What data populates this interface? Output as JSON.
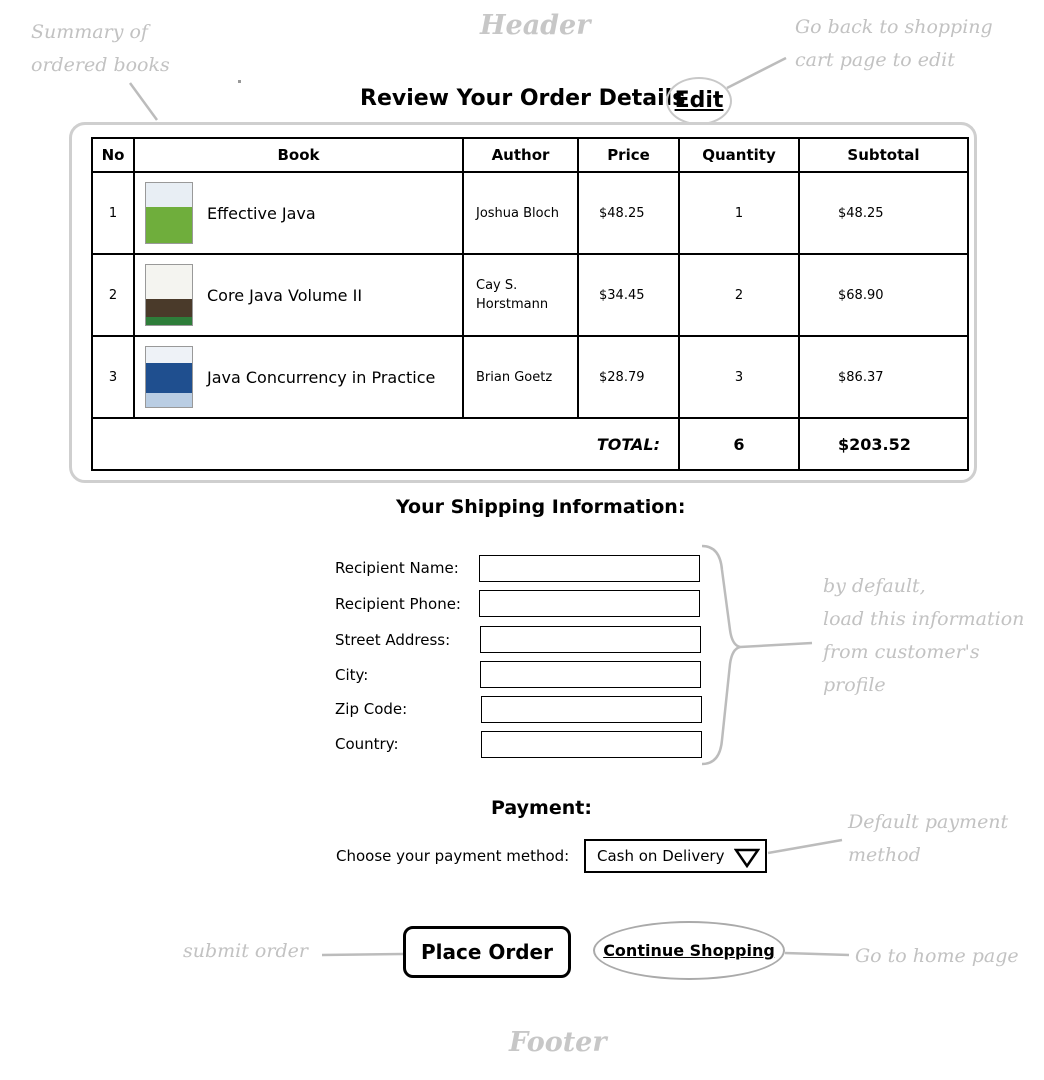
{
  "annotations": {
    "header": "Header",
    "footer": "Footer",
    "summary_note": "Summary of\nordered books",
    "edit_note": "Go back to shopping\ncart page to edit",
    "profile_note": "by default,\nload this information\nfrom customer's\nprofile",
    "payment_note": "Default payment\nmethod",
    "submit_note": "submit order",
    "home_note": "Go to home page"
  },
  "order": {
    "title": "Review Your Order Details",
    "edit_label": "Edit",
    "columns": [
      "No",
      "Book",
      "Author",
      "Price",
      "Quantity",
      "Subtotal"
    ],
    "rows": [
      {
        "no": "1",
        "book": "Effective Java",
        "author": "Joshua Bloch",
        "price": "$48.25",
        "quantity": "1",
        "subtotal": "$48.25",
        "cover_color": "#6fae3c"
      },
      {
        "no": "2",
        "book": "Core Java Volume II",
        "author": "Cay S. Horstmann",
        "price": "$34.45",
        "quantity": "2",
        "subtotal": "$68.90",
        "cover_color": "#2e7d3a"
      },
      {
        "no": "3",
        "book": "Java Concurrency in Practice",
        "author": "Brian Goetz",
        "price": "$28.79",
        "quantity": "3",
        "subtotal": "$86.37",
        "cover_color": "#1f4f8f"
      }
    ],
    "total_label": "TOTAL:",
    "total_quantity": "6",
    "total_amount": "$203.52"
  },
  "shipping": {
    "title": "Your Shipping Information:",
    "fields": [
      {
        "label": "Recipient Name:",
        "value": ""
      },
      {
        "label": "Recipient Phone:",
        "value": ""
      },
      {
        "label": "Street Address:",
        "value": ""
      },
      {
        "label": "City:",
        "value": ""
      },
      {
        "label": "Zip Code:",
        "value": ""
      },
      {
        "label": "Country:",
        "value": ""
      }
    ]
  },
  "payment": {
    "title": "Payment:",
    "method_label": "Choose your payment method:",
    "method_value": "Cash on Delivery"
  },
  "actions": {
    "place_order": "Place Order",
    "continue_shopping": "Continue Shopping"
  }
}
